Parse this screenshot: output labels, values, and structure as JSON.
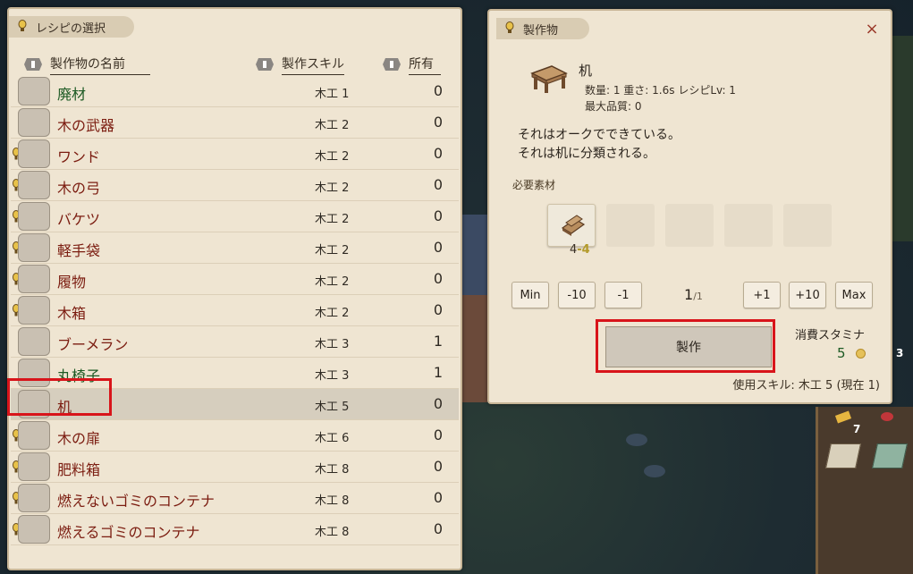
{
  "left_panel": {
    "title": "レシピの選択",
    "columns": {
      "name": "製作物の名前",
      "skill": "製作スキル",
      "owned": "所有"
    },
    "recipes": [
      {
        "name": "廃材",
        "skill": "木工 1",
        "owned": "0",
        "bulb": false,
        "color": "green",
        "icon": "wood-scrap-icon"
      },
      {
        "name": "木の武器",
        "skill": "木工 2",
        "owned": "0",
        "bulb": false,
        "color": "red",
        "icon": "wooden-sword-icon"
      },
      {
        "name": "ワンド",
        "skill": "木工 2",
        "owned": "0",
        "bulb": true,
        "color": "red",
        "icon": "wand-icon"
      },
      {
        "name": "木の弓",
        "skill": "木工 2",
        "owned": "0",
        "bulb": true,
        "color": "red",
        "icon": "bow-icon"
      },
      {
        "name": "バケツ",
        "skill": "木工 2",
        "owned": "0",
        "bulb": true,
        "color": "red",
        "icon": "bucket-icon"
      },
      {
        "name": "軽手袋",
        "skill": "木工 2",
        "owned": "0",
        "bulb": true,
        "color": "red",
        "icon": "glove-icon"
      },
      {
        "name": "履物",
        "skill": "木工 2",
        "owned": "0",
        "bulb": true,
        "color": "red",
        "icon": "boots-icon"
      },
      {
        "name": "木箱",
        "skill": "木工 2",
        "owned": "0",
        "bulb": true,
        "color": "red",
        "icon": "wooden-box-icon"
      },
      {
        "name": "ブーメラン",
        "skill": "木工 3",
        "owned": "1",
        "bulb": false,
        "color": "red",
        "icon": "boomerang-icon"
      },
      {
        "name": "丸椅子",
        "skill": "木工 3",
        "owned": "1",
        "bulb": false,
        "color": "green",
        "icon": "stool-icon"
      },
      {
        "name": "机",
        "skill": "木工 5",
        "owned": "0",
        "bulb": false,
        "color": "red",
        "icon": "desk-icon",
        "selected": true
      },
      {
        "name": "木の扉",
        "skill": "木工 6",
        "owned": "0",
        "bulb": true,
        "color": "red",
        "icon": "wooden-door-icon"
      },
      {
        "name": "肥料箱",
        "skill": "木工 8",
        "owned": "0",
        "bulb": true,
        "color": "red",
        "icon": "fertilizer-box-icon"
      },
      {
        "name": "燃えないゴミのコンテナ",
        "skill": "木工 8",
        "owned": "0",
        "bulb": true,
        "color": "red",
        "icon": "nonburnable-bin-icon"
      },
      {
        "name": "燃えるゴミのコンテナ",
        "skill": "木工 8",
        "owned": "0",
        "bulb": true,
        "color": "red",
        "icon": "burnable-bin-icon"
      }
    ]
  },
  "right_panel": {
    "title": "製作物",
    "close": "×",
    "item_name": "机",
    "meta_line1": "数量: 1  重さ: 1.6s  レシピLv: 1",
    "meta_line2": "最大品質: 0",
    "desc1": "それはオークでできている。",
    "desc2": "それは机に分類される。",
    "materials_label": "必要素材",
    "material_count": "4",
    "material_need": "-4",
    "buttons": {
      "min": "Min",
      "minus10": "-10",
      "minus1": "-1",
      "plus1": "+1",
      "plus10": "+10",
      "max": "Max"
    },
    "quantity": "1",
    "quantity_total": "/1",
    "craft_label": "製作",
    "stamina_label": "消費スタミナ",
    "stamina_value": "5",
    "skill_used": "使用スキル: 木工 5 (現在 1)"
  },
  "hud": {
    "count1": "7",
    "count2": "3"
  },
  "colors": {
    "selected_outline": "#d8141a",
    "name_red": "#7b1c10",
    "name_green": "#1d5a24"
  }
}
